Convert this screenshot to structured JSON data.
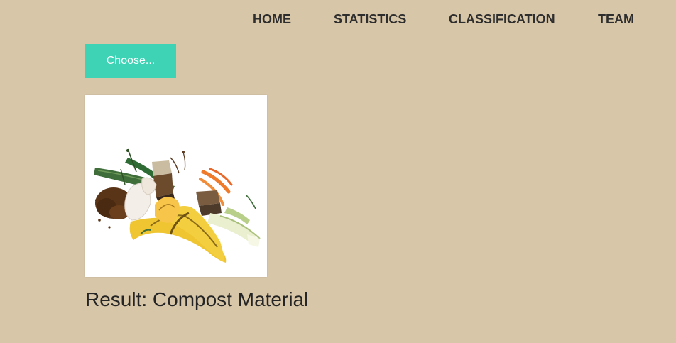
{
  "nav": {
    "items": [
      {
        "label": "HOME"
      },
      {
        "label": "STATISTICS"
      },
      {
        "label": "CLASSIFICATION"
      },
      {
        "label": "TEAM"
      }
    ]
  },
  "upload": {
    "button_label": "Choose..."
  },
  "preview": {
    "image_name": "compost-waste-image"
  },
  "result": {
    "text": "Result: Compost Material"
  },
  "colors": {
    "background": "#d8c6a8",
    "accent": "#3ed3b5",
    "text": "#2e2e2e"
  }
}
